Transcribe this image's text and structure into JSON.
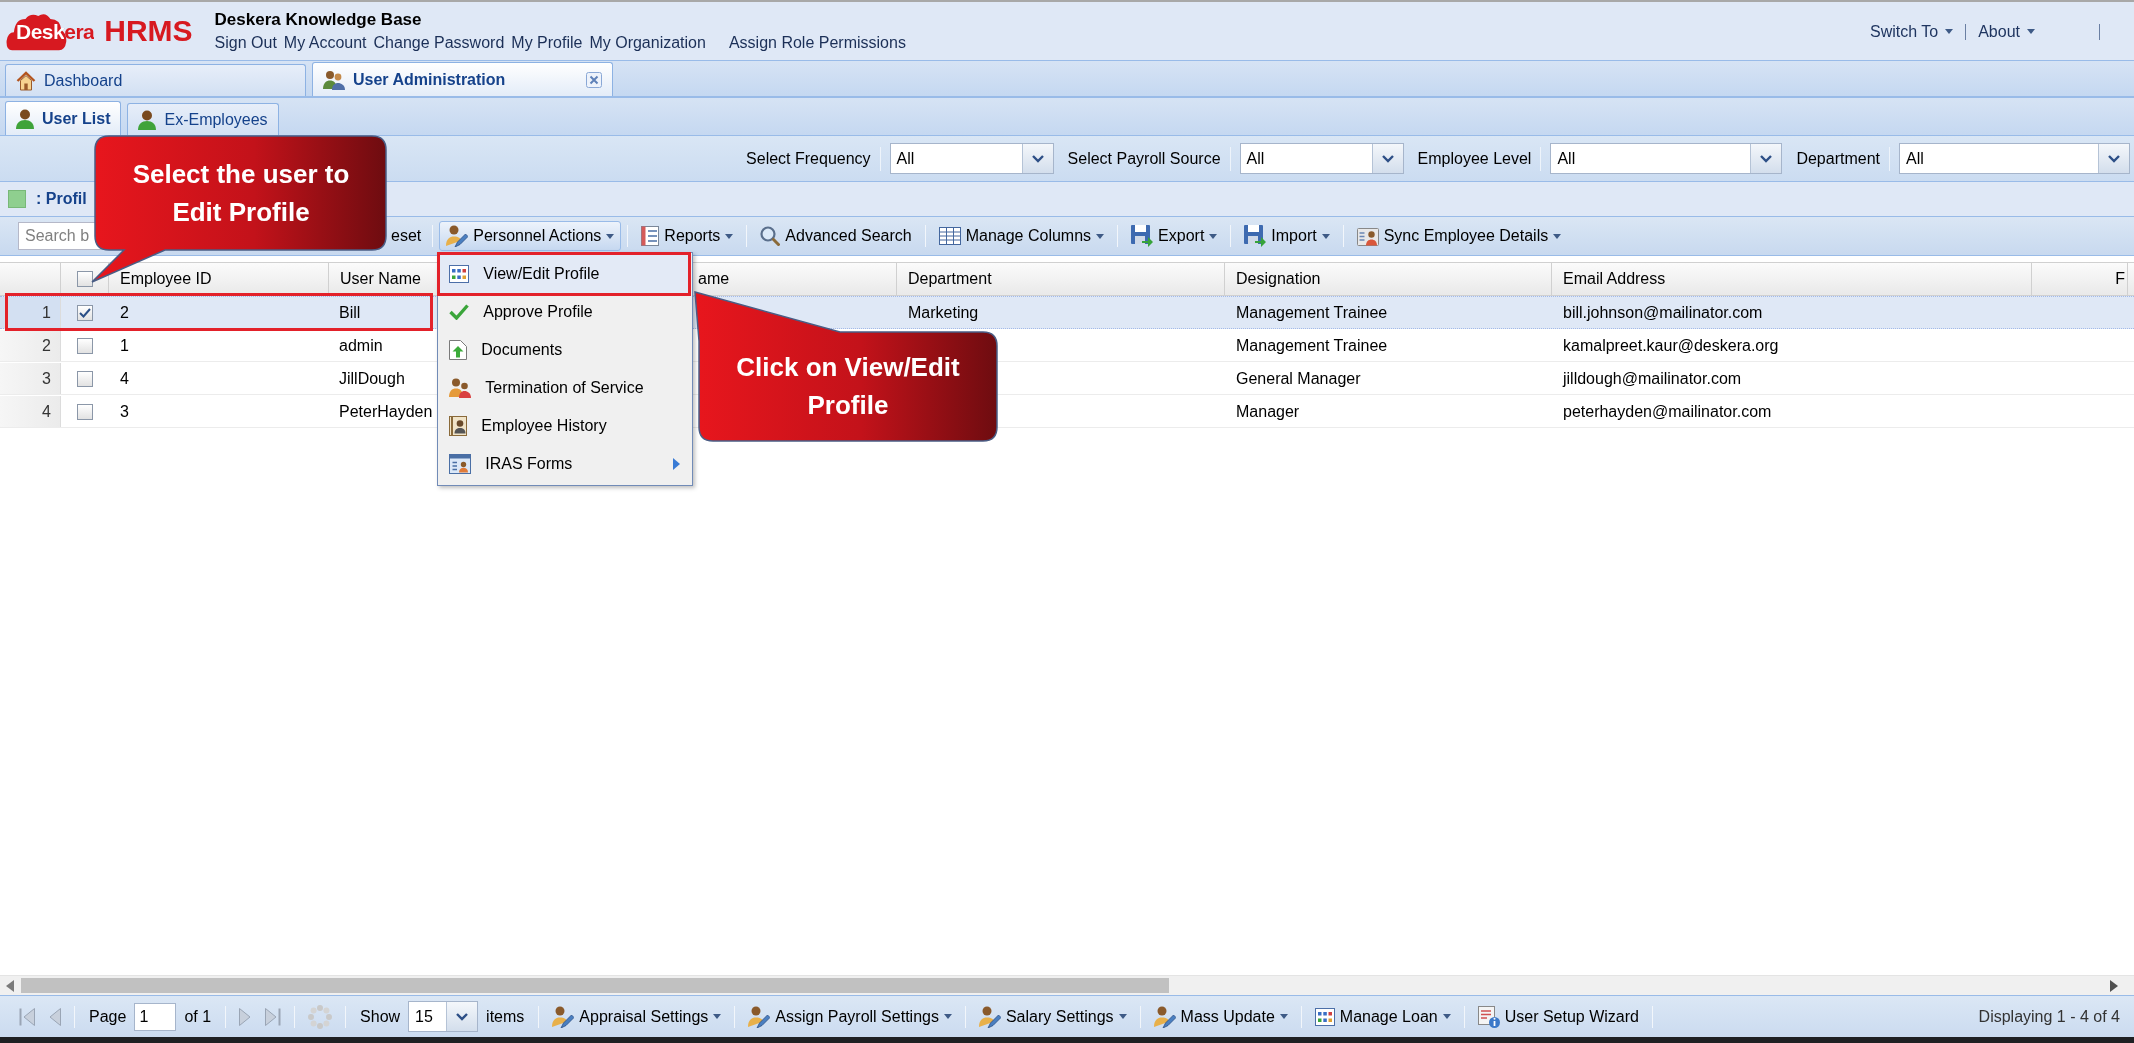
{
  "header": {
    "logo": {
      "mark": "Deskera",
      "product": "HRMS"
    },
    "title": "Deskera Knowledge Base",
    "links": [
      "Sign Out",
      "My Account",
      "Change Password",
      "My Profile",
      "My Organization",
      "Assign Role Permissions"
    ],
    "menus": [
      "Switch To",
      "About"
    ]
  },
  "main_tabs": [
    {
      "label": "Dashboard",
      "selected": false,
      "closable": false
    },
    {
      "label": "User Administration",
      "selected": true,
      "closable": true
    }
  ],
  "sub_tabs": [
    {
      "label": "User List",
      "selected": true
    },
    {
      "label": "Ex-Employees",
      "selected": false
    }
  ],
  "filters": [
    {
      "label": "Select Frequency",
      "value": "All"
    },
    {
      "label": "Select Payroll Source",
      "value": "All"
    },
    {
      "label": "Employee Level",
      "value": "All"
    },
    {
      "label": "Department",
      "value": "All"
    }
  ],
  "panel": {
    "title": ": Profil"
  },
  "toolbar": {
    "search": {
      "placeholder": "Search b"
    },
    "reset": {
      "label": "eset"
    },
    "buttons": [
      {
        "label": "Personnel Actions",
        "dropdown": true,
        "pressed": true
      },
      {
        "label": "Reports",
        "dropdown": true,
        "pressed": false
      },
      {
        "label": "Advanced Search",
        "dropdown": false,
        "pressed": false
      },
      {
        "label": "Manage Columns",
        "dropdown": true,
        "pressed": false
      },
      {
        "label": "Export",
        "dropdown": true,
        "pressed": false
      },
      {
        "label": "Import",
        "dropdown": true,
        "pressed": false
      },
      {
        "label": "Sync Employee Details",
        "dropdown": true,
        "pressed": false
      }
    ]
  },
  "grid": {
    "select_all": {
      "checked": false
    },
    "columns": [
      {
        "label": "Employee ID"
      },
      {
        "label": "User Name"
      },
      {
        "label": "ame"
      },
      {
        "label": "Department"
      },
      {
        "label": "Designation"
      },
      {
        "label": "Email Address"
      },
      {
        "label": "F"
      }
    ],
    "rows": [
      {
        "number": "1",
        "checked": true,
        "selected": true,
        "framed": true,
        "employee_id": "2",
        "user_name": "Bill",
        "department": "Marketing",
        "designation": "Management Trainee",
        "email_address": "bill.johnson@mailinator.com"
      },
      {
        "number": "2",
        "checked": false,
        "selected": false,
        "framed": false,
        "employee_id": "1",
        "user_name": "admin",
        "designation": "Management Trainee",
        "email_address": "kamalpreet.kaur@deskera.org"
      },
      {
        "number": "3",
        "checked": false,
        "selected": false,
        "framed": false,
        "employee_id": "4",
        "user_name": "JillDough",
        "designation": "General Manager",
        "email_address": "jilldough@mailinator.com"
      },
      {
        "number": "4",
        "checked": false,
        "selected": false,
        "framed": false,
        "employee_id": "3",
        "user_name": "PeterHayden",
        "designation": "Manager",
        "email_address": "peterhayden@mailinator.com"
      }
    ]
  },
  "menu": {
    "items": [
      {
        "label": "View/Edit Profile",
        "highlighted": true,
        "framed": true,
        "submenu": false
      },
      {
        "label": "Approve Profile",
        "highlighted": false,
        "framed": false,
        "submenu": false
      },
      {
        "label": "Documents",
        "highlighted": false,
        "framed": false,
        "submenu": false
      },
      {
        "label": "Termination of Service",
        "highlighted": false,
        "framed": false,
        "submenu": false
      },
      {
        "label": "Employee History",
        "highlighted": false,
        "framed": false,
        "submenu": false
      },
      {
        "label": "IRAS Forms",
        "highlighted": false,
        "framed": false,
        "submenu": true
      }
    ]
  },
  "annotations": [
    {
      "text": "Select the user to Edit Profile"
    },
    {
      "text": "Click on View/Edit Profile"
    }
  ],
  "pager": {
    "page_label": "Page",
    "page": "1",
    "page_count": "of 1",
    "show_label": "Show",
    "page_size": "15",
    "items_label": "items",
    "buttons": [
      {
        "label": "Appraisal Settings",
        "dropdown": true
      },
      {
        "label": "Assign Payroll Settings",
        "dropdown": true
      },
      {
        "label": "Salary Settings",
        "dropdown": true
      },
      {
        "label": "Mass Update",
        "dropdown": true
      },
      {
        "label": "Manage Loan",
        "dropdown": true
      },
      {
        "label": "User Setup Wizard",
        "dropdown": false
      }
    ],
    "display": "Displaying 1 - 4 of 4"
  }
}
